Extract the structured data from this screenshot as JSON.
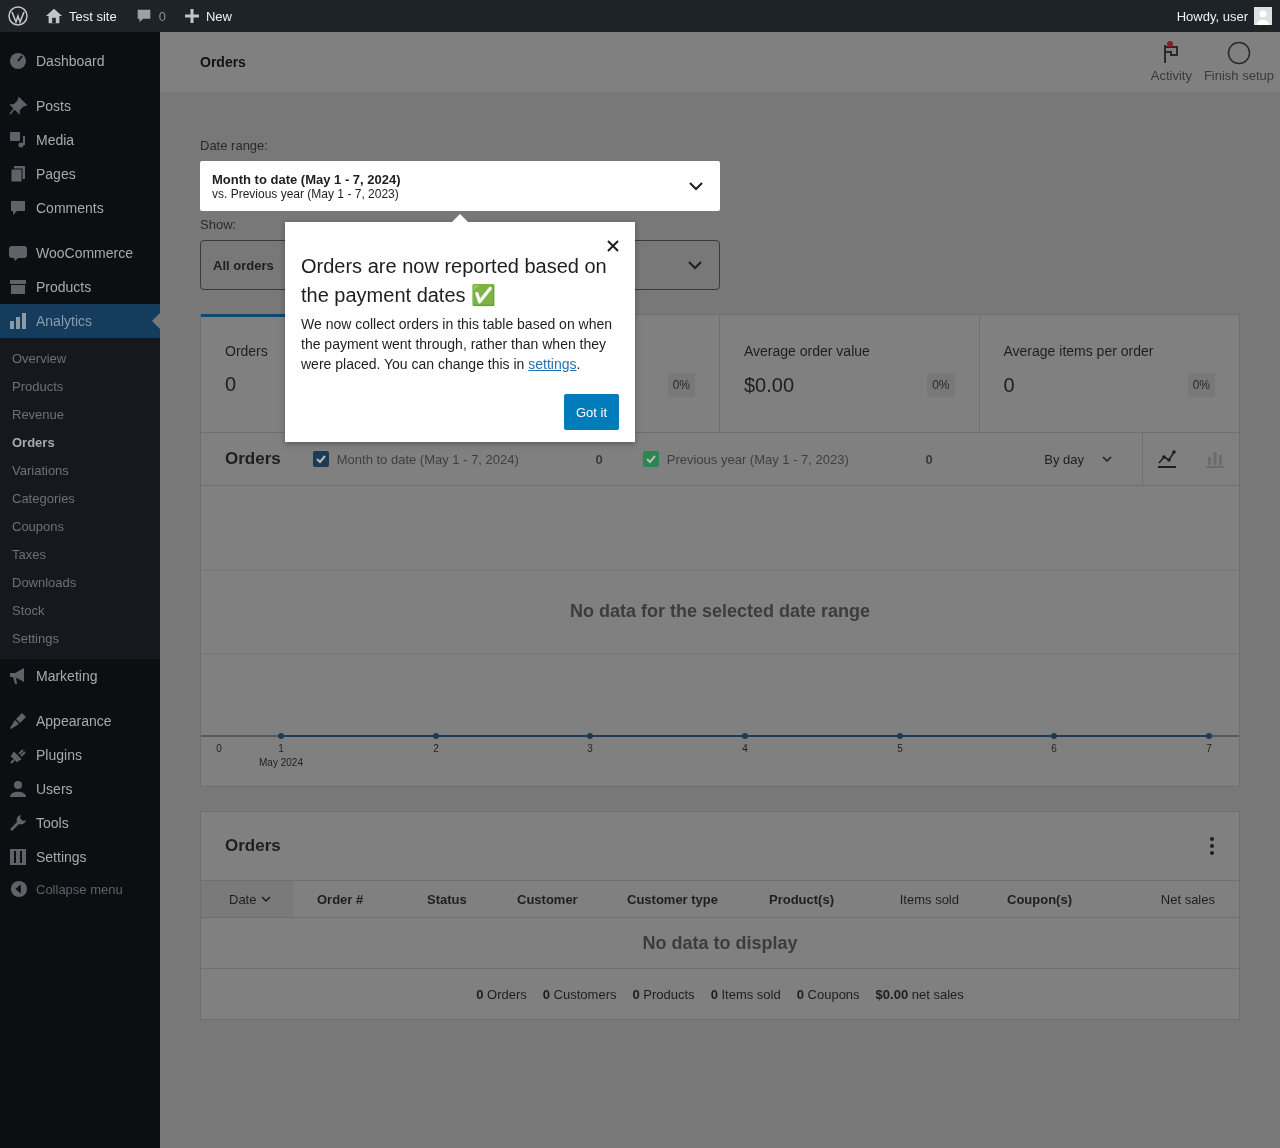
{
  "admin_bar": {
    "site": "Test site",
    "comments": "0",
    "new": "New",
    "greeting": "Howdy, user"
  },
  "header": {
    "title": "Orders",
    "actions": [
      {
        "label": "Activity",
        "kind": "activity"
      },
      {
        "label": "Finish setup",
        "kind": "setup"
      }
    ]
  },
  "sidebar": {
    "groups": [
      [
        {
          "label": "Dashboard",
          "selected": false
        }
      ],
      [
        {
          "label": "Posts",
          "selected": false
        },
        {
          "label": "Media",
          "selected": false
        },
        {
          "label": "Pages",
          "selected": false
        },
        {
          "label": "Comments",
          "selected": false
        }
      ],
      [
        {
          "label": "WooCommerce",
          "selected": false
        },
        {
          "label": "Products",
          "selected": false
        },
        {
          "label": "Analytics",
          "selected": true,
          "children": [
            {
              "label": "Overview",
              "selected": false
            },
            {
              "label": "Products",
              "selected": false
            },
            {
              "label": "Revenue",
              "selected": false
            },
            {
              "label": "Orders",
              "selected": true
            },
            {
              "label": "Variations",
              "selected": false
            },
            {
              "label": "Categories",
              "selected": false
            },
            {
              "label": "Coupons",
              "selected": false
            },
            {
              "label": "Taxes",
              "selected": false
            },
            {
              "label": "Downloads",
              "selected": false
            },
            {
              "label": "Stock",
              "selected": false
            },
            {
              "label": "Settings",
              "selected": false
            }
          ]
        },
        {
          "label": "Marketing",
          "selected": false
        }
      ],
      [
        {
          "label": "Appearance",
          "selected": false
        },
        {
          "label": "Plugins",
          "selected": false
        },
        {
          "label": "Users",
          "selected": false
        },
        {
          "label": "Tools",
          "selected": false
        },
        {
          "label": "Settings",
          "selected": false
        }
      ]
    ],
    "collapse": "Collapse menu"
  },
  "filters": {
    "date_label": "Date range:",
    "date_value": "Month to date (May 1 - 7, 2024)",
    "date_compare": "vs. Previous year (May 1 - 7, 2023)",
    "show_label": "Show:",
    "show_value": "All orders"
  },
  "stats": [
    {
      "label": "Orders",
      "value": "0",
      "selected": true
    },
    {
      "delta": "0%",
      "selected": false
    },
    {
      "label": "Average order value",
      "value": "$0.00",
      "delta": "0%",
      "selected": false
    },
    {
      "label": "Average items per order",
      "value": "0",
      "delta": "0%",
      "selected": false
    }
  ],
  "chart": {
    "title": "Orders",
    "legend": [
      {
        "label": "Month to date (May 1 - 7, 2024)",
        "total": "0",
        "checked": true,
        "color": "#1d3a55"
      },
      {
        "label": "Previous year (May 1 - 7, 2023)",
        "total": "0",
        "checked": true,
        "color": "#2d8650"
      }
    ],
    "interval": "By day",
    "views": [
      {
        "kind": "line",
        "selected": true
      },
      {
        "kind": "bar",
        "selected": false
      }
    ],
    "empty": "No data for the selected date range",
    "x_labels": [
      "0",
      "1",
      "2",
      "3",
      "4",
      "5",
      "6",
      "7"
    ],
    "x_sublabel": "May 2024"
  },
  "table": {
    "title": "Orders",
    "columns": [
      {
        "label": "Date",
        "kind": "sort"
      },
      {
        "label": "Order #",
        "kind": "text"
      },
      {
        "label": "Status",
        "kind": "text"
      },
      {
        "label": "Customer",
        "kind": "text"
      },
      {
        "label": "Customer type",
        "kind": "text"
      },
      {
        "label": "Product(s)",
        "kind": "text"
      },
      {
        "label": "Items sold",
        "kind": "number"
      },
      {
        "label": "Coupon(s)",
        "kind": "text"
      },
      {
        "label": "Net sales",
        "kind": "number"
      }
    ],
    "empty": "No data to display",
    "summary": [
      "**0** Orders",
      "**0** Customers",
      "**0** Products",
      "**0** Items sold",
      "**0** Coupons",
      "**$0.00** net sales"
    ]
  },
  "popover": {
    "title": "Orders are now reported based on the payment dates ✅",
    "body_before": "We now collect orders in this table based on when the payment went through, rather than when they were placed. You can change this in ",
    "link": "settings",
    "body_after": ".",
    "button": "Got it"
  }
}
